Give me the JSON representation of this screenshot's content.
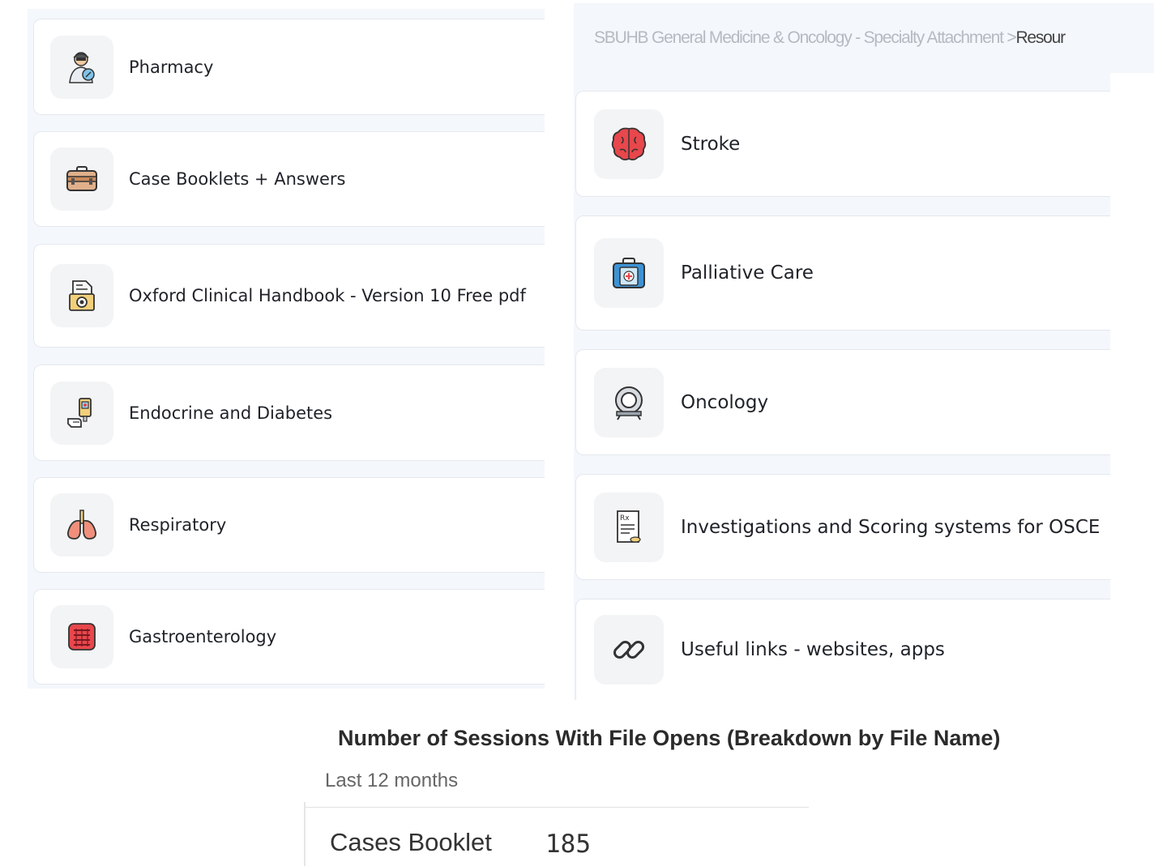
{
  "breadcrumb": {
    "path": "SBUHB General Medicine & Oncology - Specialty Attachment > ",
    "current": "Resour"
  },
  "left_items": [
    {
      "label": "Pharmacy",
      "icon": "pharmacist-icon"
    },
    {
      "label": "Case Booklets + Answers",
      "icon": "briefcase-icon"
    },
    {
      "label": "Oxford Clinical Handbook - Version 10 Free pdf",
      "icon": "pdf-document-icon"
    },
    {
      "label": "Endocrine and Diabetes",
      "icon": "glucose-meter-icon"
    },
    {
      "label": "Respiratory",
      "icon": "lungs-icon"
    },
    {
      "label": "Gastroenterology",
      "icon": "intestine-icon"
    }
  ],
  "right_items": [
    {
      "label": "Stroke",
      "icon": "brain-icon"
    },
    {
      "label": "Palliative Care",
      "icon": "first-aid-kit-icon"
    },
    {
      "label": "Oncology",
      "icon": "mri-scanner-icon"
    },
    {
      "label": "Investigations and Scoring systems for OSCE",
      "icon": "prescription-icon"
    },
    {
      "label": "Useful links - websites, apps",
      "icon": "link-icon"
    }
  ],
  "report": {
    "title": "Number of Sessions With File Opens (Breakdown by File Name)",
    "period": "Last 12 months",
    "rows": [
      {
        "name": "Cases Booklet",
        "value": "185"
      }
    ]
  },
  "colors": {
    "panel_bg": "#f4f7fb",
    "card_border": "#e4e8ef",
    "icon_bg": "#f3f4f6",
    "brain_red": "#e8474c",
    "kit_blue": "#3d93d6"
  }
}
